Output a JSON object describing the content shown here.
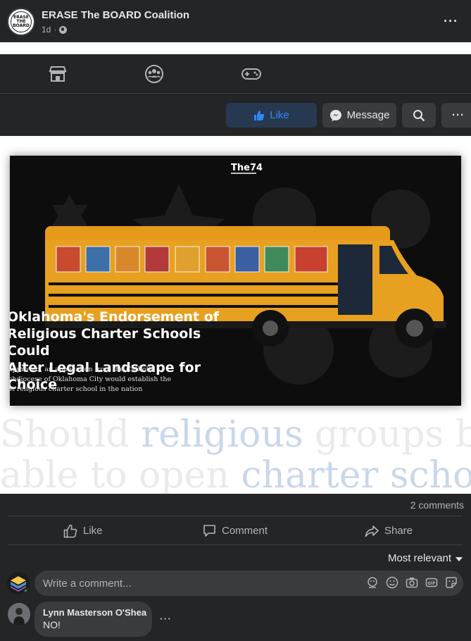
{
  "post": {
    "page_name": "ERASE The BOARD Coalition",
    "time": "1d",
    "time_separator": "·",
    "avatar_text": "ERASE THE BOARD",
    "more_label": "···"
  },
  "nav": {
    "icons": [
      "store-icon",
      "groups-icon",
      "gaming-icon"
    ]
  },
  "actions": {
    "like_label": "Like",
    "message_label": "Message",
    "more_label": "···",
    "accent": "#2d88ff"
  },
  "article": {
    "brand": "The74",
    "headline": "Oklahoma's Endorsement of\nReligious Charter Schools Could\nAlter Legal Landscape for Choice",
    "subtext": "approved, an application from the Catholic\nchdiocese of Oklahoma City would establish the\nst religious charter school in the nation",
    "question_part1": "Should ",
    "question_hl1": "religious",
    "question_part2": " groups be",
    "question_line2a": "able to open ",
    "question_hl2": "charter schools",
    "question_line2b": "?"
  },
  "stats": {
    "comments": "2 comments"
  },
  "reactions": {
    "like": "Like",
    "comment": "Comment",
    "share": "Share"
  },
  "sort": {
    "label": "Most relevant"
  },
  "composer": {
    "placeholder": "Write a comment..."
  },
  "comments": [
    {
      "author": "Lynn Masterson O'Shea",
      "text": "NO!"
    }
  ]
}
